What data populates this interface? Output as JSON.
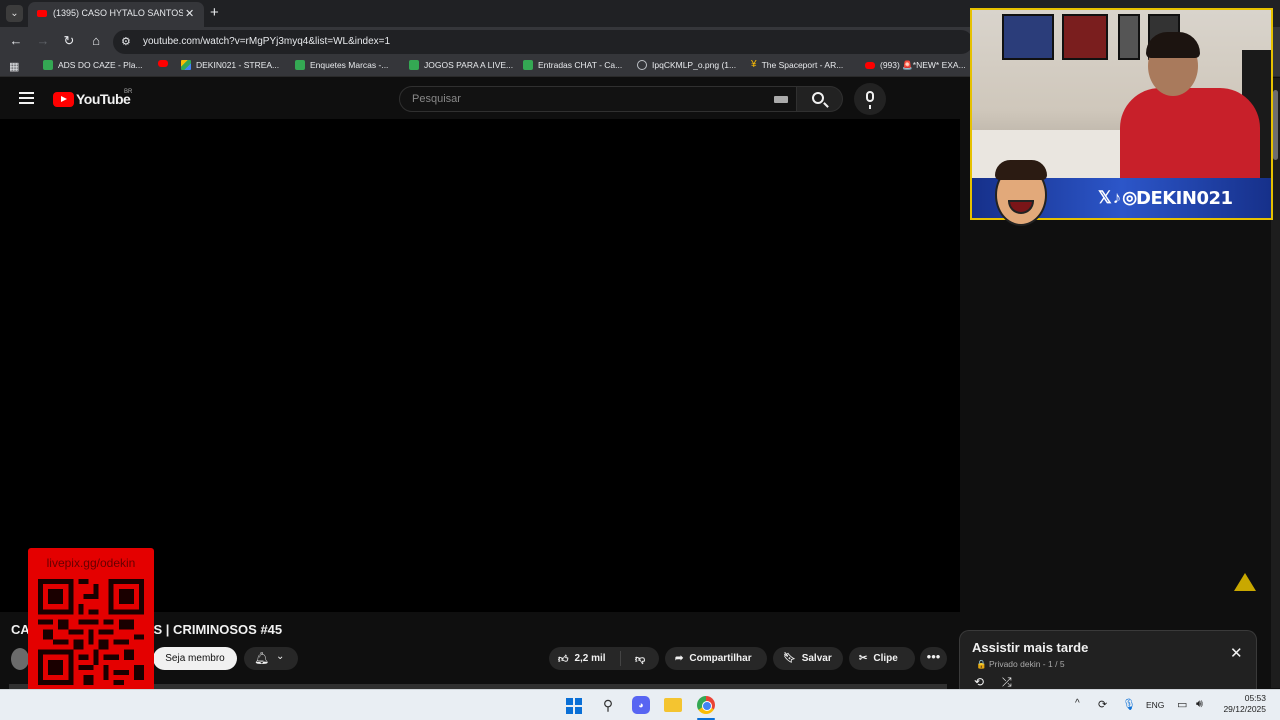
{
  "browser": {
    "tab_title": "(1395) CASO HYTALO SANTOS",
    "tab_close": "✕",
    "new_tab": "+",
    "url": "youtube.com/watch?v=rMgPYj3myq4&list=WL&index=1",
    "bookmarks": [
      {
        "label": "ADS DO CAZE - Pla...",
        "icon": "sheet"
      },
      {
        "label": "",
        "icon": "yt"
      },
      {
        "label": "DEKIN021 - STREA...",
        "icon": "drive"
      },
      {
        "label": "Enquetes Marcas -...",
        "icon": "sheet"
      },
      {
        "label": "JOGOS PARA A LIVE...",
        "icon": "sheet"
      },
      {
        "label": "Entradas CHAT - Ca...",
        "icon": "sheet"
      },
      {
        "label": "IpqCKMLP_o.png (1...",
        "icon": "globe"
      },
      {
        "label": "The Spaceport - AR...",
        "icon": "spaceport"
      },
      {
        "label": "(993) 🚨*NEW* EXA...",
        "icon": "yt"
      }
    ]
  },
  "youtube": {
    "logo_text": "YouTube",
    "region": "BR",
    "search_placeholder": "Pesquisar",
    "video_title": "CASO HYTALO SANTOS | CRIMINOSOS #45",
    "join_label": "Seja membro",
    "like_count": "2,2 mil",
    "share_label": "Compartilhar",
    "save_label": "Salvar",
    "clip_label": "Clipe",
    "more_label": "•••",
    "playlist": {
      "title": "Assistir mais tarde",
      "meta": "🔒 Privado  dekin  -  1 / 5"
    }
  },
  "overlay": {
    "qr_label": "livepix.gg/odekin",
    "banner_social": "𝕏♪◎",
    "banner_name": "DEKIN021"
  },
  "taskbar": {
    "lang": "ENG",
    "time": "05:53",
    "date": "29/12/2025"
  },
  "colors": {
    "youtube_red": "#ff0000",
    "background": "#0f0f0f",
    "overlay_red": "#e40000",
    "banner_blue": "#2c56c9",
    "windows_blue": "#0a6fd6"
  },
  "icons": [
    "tab-menu-icon",
    "youtube-favicon",
    "back-icon",
    "forward-icon",
    "reload-icon",
    "home-icon",
    "site-info-icon",
    "apps-icon",
    "hamburger-icon",
    "keyboard-icon",
    "search-icon",
    "mic-icon",
    "bell-icon",
    "like-icon",
    "dislike-icon",
    "share-icon",
    "save-icon",
    "scissors-icon",
    "close-icon",
    "loop-icon",
    "shuffle-icon",
    "windows-start-icon",
    "discord-icon",
    "folder-icon",
    "chrome-icon"
  ]
}
